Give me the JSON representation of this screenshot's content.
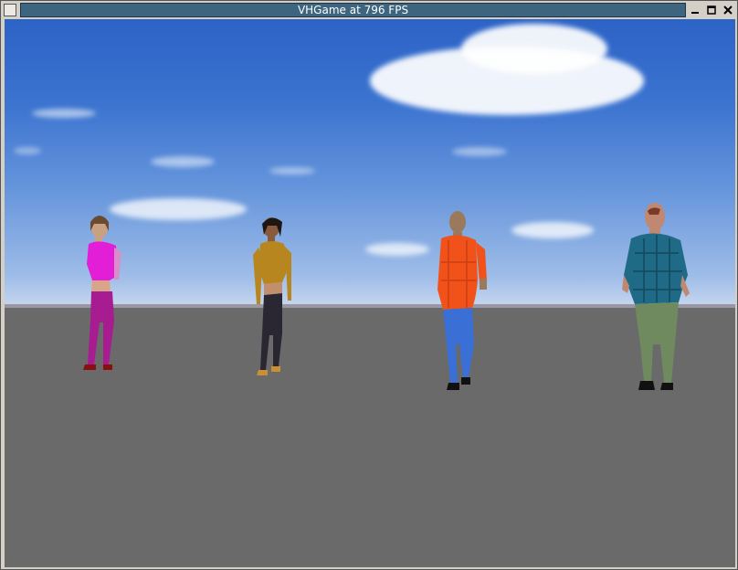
{
  "window": {
    "title": "VHGame at 796 FPS",
    "controls": [
      "minimize-icon",
      "maximize-icon",
      "close-icon"
    ]
  },
  "scene": {
    "sky_color": "#3c74d0",
    "ground_color": "#6a6a6a",
    "characters": [
      {
        "name": "woman-pink-top",
        "shirt_color": "#e21fd6",
        "pants_color": "#a81c92"
      },
      {
        "name": "woman-gold-top",
        "shirt_color": "#b8861e",
        "pants_color": "#2a2733"
      },
      {
        "name": "man-orange-plaid",
        "shirt_color": "#f0521a",
        "pants_color": "#3a6fd6"
      },
      {
        "name": "man-blue-plaid",
        "shirt_color": "#1f6a86",
        "pants_color": "#6f8a5f"
      }
    ]
  }
}
